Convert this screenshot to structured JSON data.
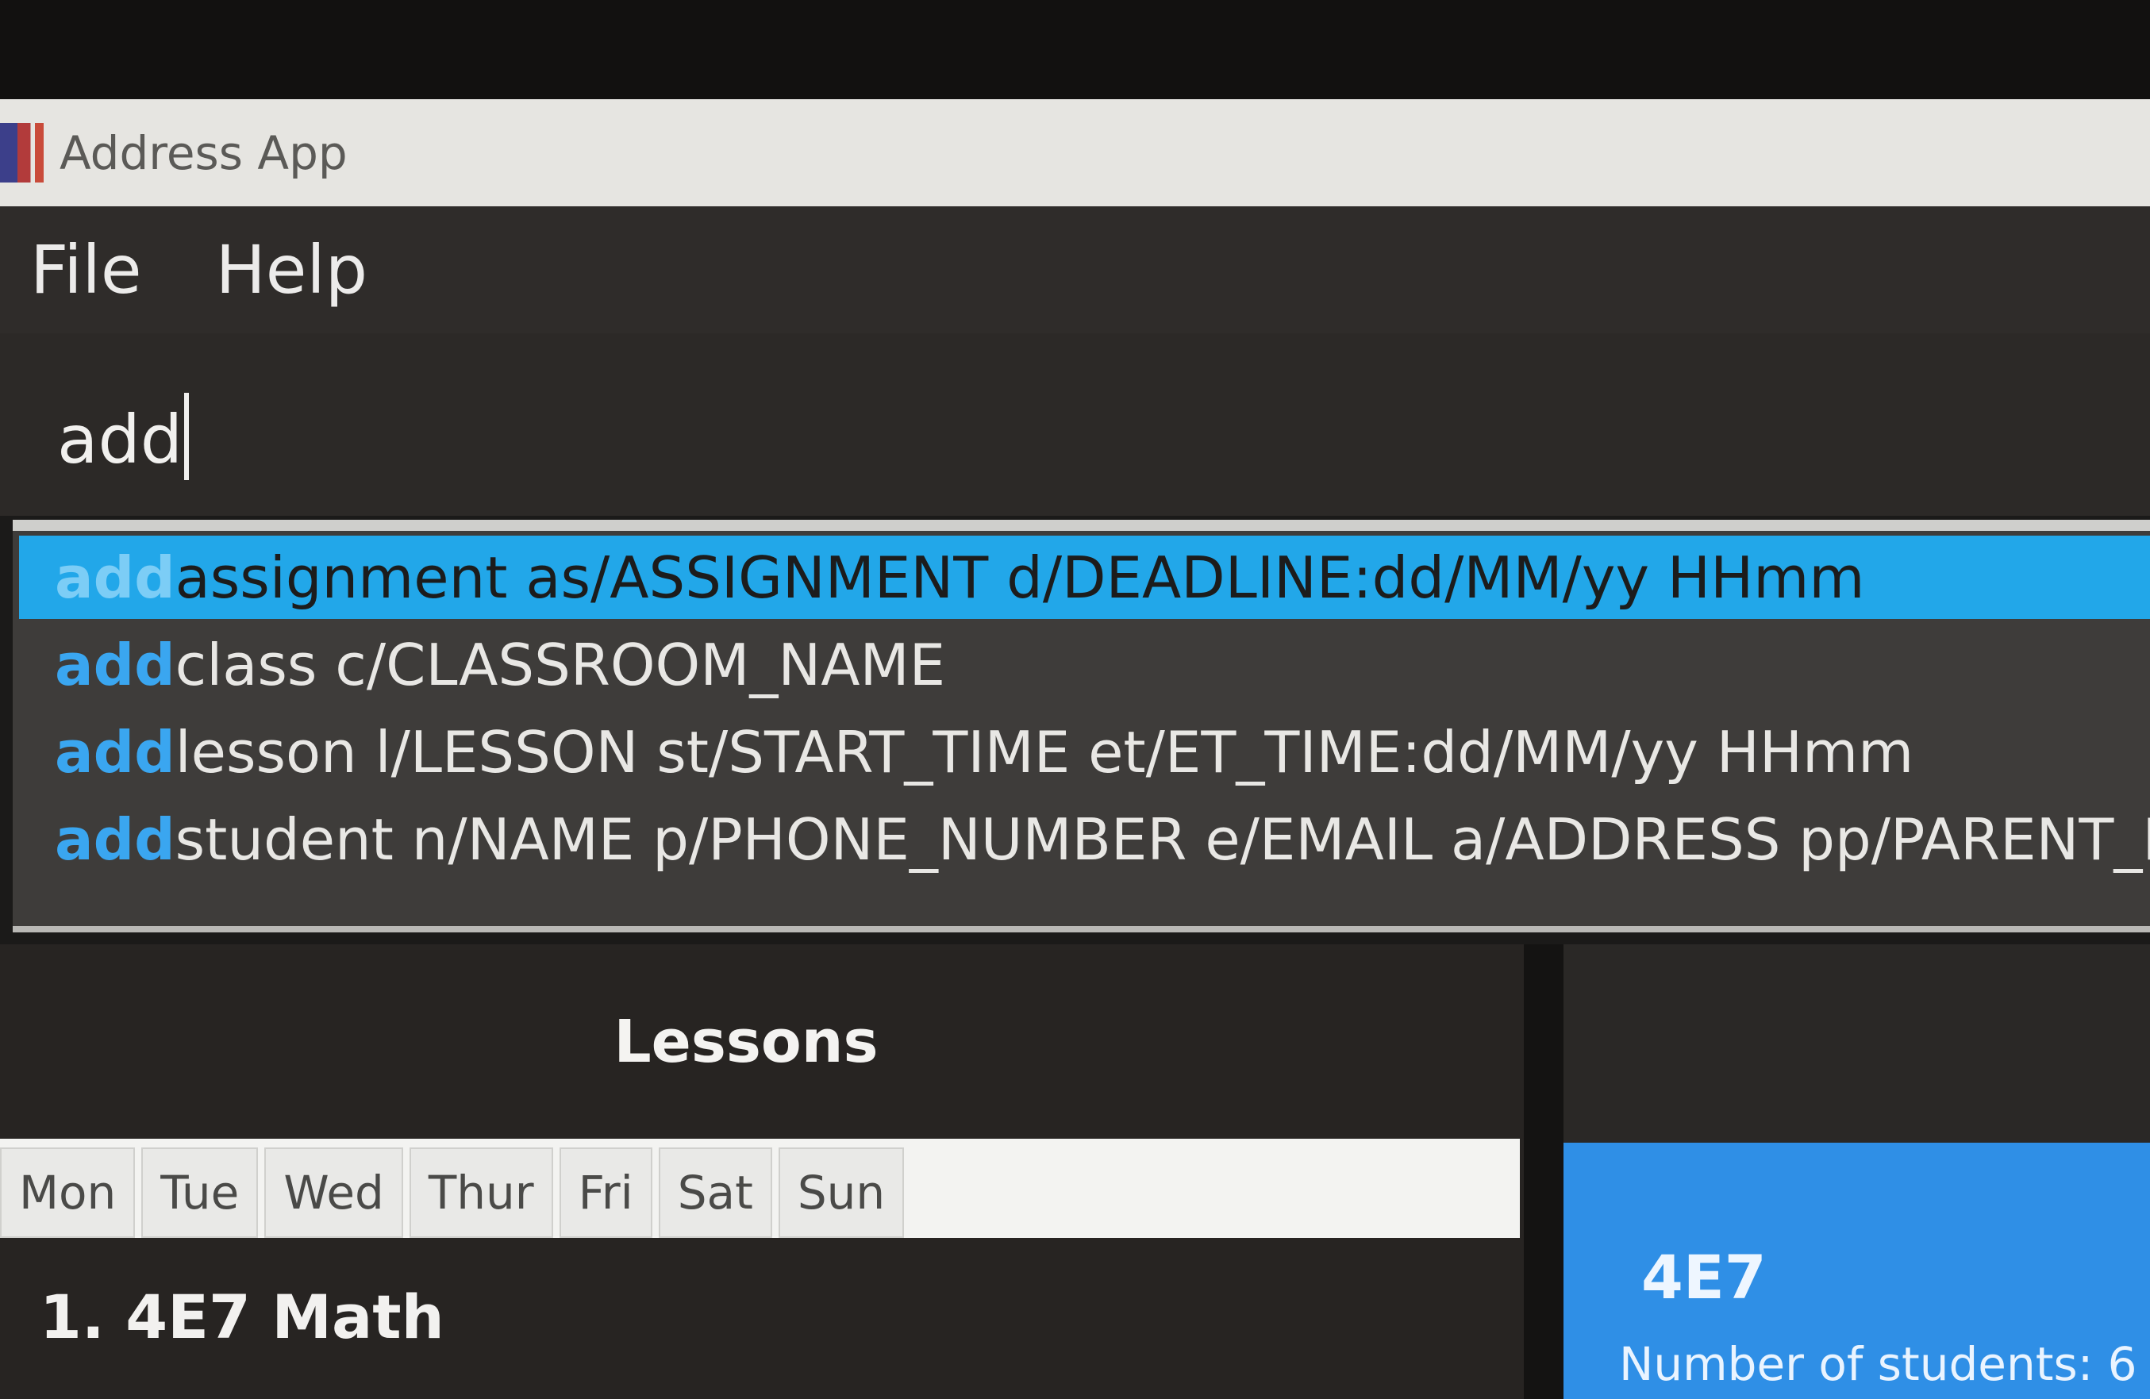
{
  "window": {
    "title": "Address App"
  },
  "menu": {
    "items": [
      "File",
      "Help"
    ]
  },
  "command": {
    "value": "add"
  },
  "suggestions": [
    {
      "prefix": "add",
      "rest": "assignment as/ASSIGNMENT d/DEADLINE:dd/MM/yy HHmm",
      "selected": true
    },
    {
      "prefix": "add",
      "rest": "class c/CLASSROOM_NAME",
      "selected": false
    },
    {
      "prefix": "add",
      "rest": "lesson l/LESSON st/START_TIME et/ET_TIME:dd/MM/yy HHmm",
      "selected": false
    },
    {
      "prefix": "add",
      "rest": "student n/NAME p/PHONE_NUMBER e/EMAIL a/ADDRESS pp/PARENT_PHON",
      "selected": false
    }
  ],
  "lessons": {
    "title": "Lessons",
    "days": [
      "Mon",
      "Tue",
      "Wed",
      "Thur",
      "Fri",
      "Sat",
      "Sun"
    ],
    "items": [
      "1.  4E7 Math"
    ]
  },
  "classroom": {
    "name": "4E7",
    "count_text": "Number of students: 6"
  },
  "colors": {
    "selection": "#22a7e9",
    "prefix": "#3aa6f0",
    "class_card": "#2f8fe6"
  }
}
